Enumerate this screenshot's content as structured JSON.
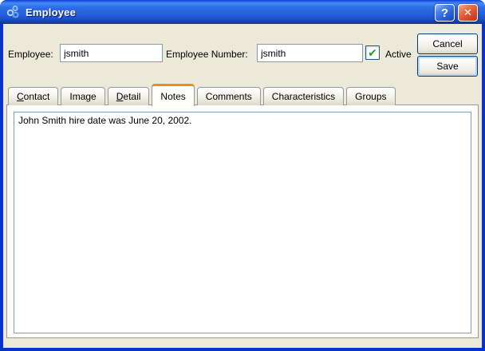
{
  "window": {
    "title": "Employee"
  },
  "titlebar_icons": {
    "help": "?",
    "close": "✕"
  },
  "form": {
    "employee_label": "Employee:",
    "employee_value": "jsmith",
    "employee_number_label": "Employee Number:",
    "employee_number_value": "jsmith",
    "active_label": "Active",
    "active_checked": true,
    "check_glyph": "✔"
  },
  "buttons": {
    "cancel": "Cancel",
    "save": "Save"
  },
  "tabs": {
    "selected": "Notes",
    "items": [
      {
        "hotkey": "C",
        "rest": "ontact"
      },
      {
        "hotkey": "",
        "rest": "Image"
      },
      {
        "hotkey": "D",
        "rest": "etail"
      },
      {
        "hotkey": "",
        "rest": "Notes"
      },
      {
        "hotkey": "",
        "rest": "Comments"
      },
      {
        "hotkey": "",
        "rest": "Characteristics"
      },
      {
        "hotkey": "",
        "rest": "Groups"
      }
    ]
  },
  "notes": {
    "text": "John Smith hire date was June 20, 2002."
  },
  "colors": {
    "titlebar_blue": "#2661dd",
    "window_border_blue": "#0832c8",
    "dialog_bg": "#ece9d8",
    "tab_accent_orange": "#e89117",
    "input_border": "#7f9db9",
    "check_green": "#21a121",
    "close_red": "#dd512b",
    "help_blue": "#2a60d8"
  }
}
